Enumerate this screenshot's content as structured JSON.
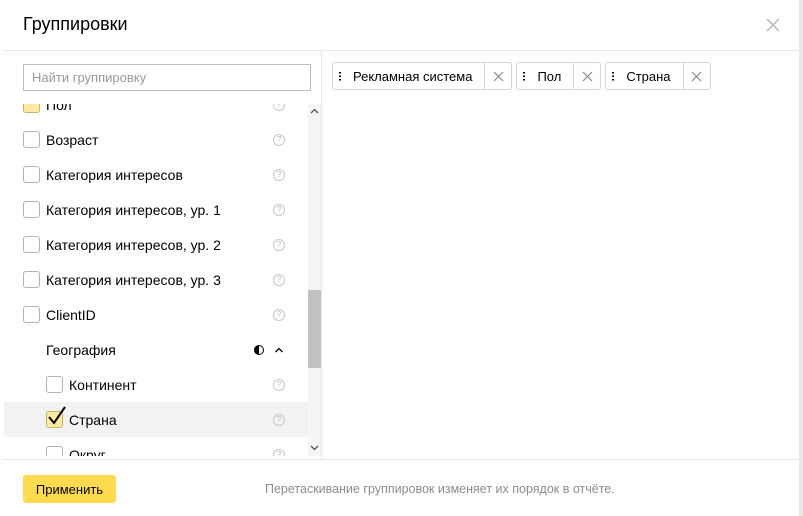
{
  "dialog": {
    "title": "Группировки",
    "close_icon": "close-icon"
  },
  "search": {
    "placeholder": "Найти группировку",
    "value": ""
  },
  "list": {
    "items": [
      {
        "label": "Пол",
        "checked": true,
        "indent": 0
      },
      {
        "label": "Возраст",
        "checked": false,
        "indent": 0
      },
      {
        "label": "Категория интересов",
        "checked": false,
        "indent": 0
      },
      {
        "label": "Категория интересов, ур. 1",
        "checked": false,
        "indent": 0
      },
      {
        "label": "Категория интересов, ур. 2",
        "checked": false,
        "indent": 0
      },
      {
        "label": "Категория интересов, ур. 3",
        "checked": false,
        "indent": 0
      },
      {
        "label": "ClientID",
        "checked": false,
        "indent": 0
      },
      {
        "label": "География",
        "group": true
      },
      {
        "label": "Континент",
        "checked": false,
        "indent": 1
      },
      {
        "label": "Страна",
        "checked": true,
        "indent": 1,
        "selected": true
      },
      {
        "label": "Округ",
        "checked": false,
        "indent": 1
      }
    ],
    "help_icon": "?"
  },
  "selected_groupings": [
    {
      "label": "Рекламная система"
    },
    {
      "label": "Пол"
    },
    {
      "label": "Страна"
    }
  ],
  "footer": {
    "apply_label": "Применить",
    "hint": "Перетаскивание группировок изменяет их порядок в отчёте."
  },
  "colors": {
    "accent": "#ffdb4d",
    "checked_bg": "#ffeba0",
    "selected_row": "#f2f2f2"
  }
}
